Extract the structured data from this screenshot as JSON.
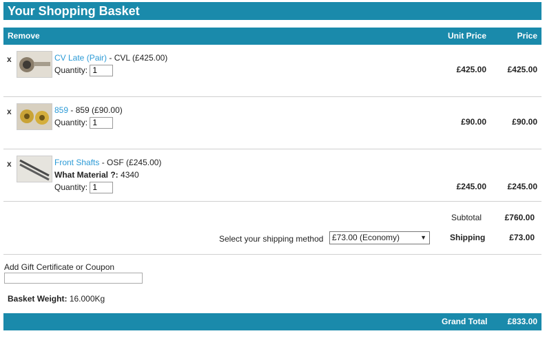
{
  "title": "Your Shopping Basket",
  "columns": {
    "remove": "Remove",
    "unit_price": "Unit Price",
    "price": "Price"
  },
  "items": [
    {
      "remove": "x",
      "name": "CV Late (Pair)",
      "variant": "- CVL (£425.00)",
      "quantity_label": "Quantity:",
      "quantity": "1",
      "unit_price": "£425.00",
      "price": "£425.00",
      "thumb_icon": "cv-joint-icon"
    },
    {
      "remove": "x",
      "name": "859",
      "variant": "- 859 (£90.00)",
      "quantity_label": "Quantity:",
      "quantity": "1",
      "unit_price": "£90.00",
      "price": "£90.00",
      "thumb_icon": "brass-parts-icon"
    },
    {
      "remove": "x",
      "name": "Front Shafts",
      "variant": "- OSF (£245.00)",
      "option_label": "What Material ?:",
      "option_value": "4340",
      "quantity_label": "Quantity:",
      "quantity": "1",
      "unit_price": "£245.00",
      "price": "£245.00",
      "thumb_icon": "shafts-icon"
    }
  ],
  "subtotal": {
    "label": "Subtotal",
    "value": "£760.00"
  },
  "shipping": {
    "select_label": "Select your shipping method",
    "selected": "£73.00 (Economy)",
    "label": "Shipping",
    "value": "£73.00"
  },
  "coupon": {
    "label": "Add Gift Certificate or Coupon",
    "value": ""
  },
  "weight": {
    "label": "Basket Weight:",
    "value": "16.000Kg"
  },
  "grand_total": {
    "label": "Grand Total",
    "value": "£833.00"
  },
  "colors": {
    "accent": "#1a8aab",
    "link": "#2b9ad6"
  }
}
